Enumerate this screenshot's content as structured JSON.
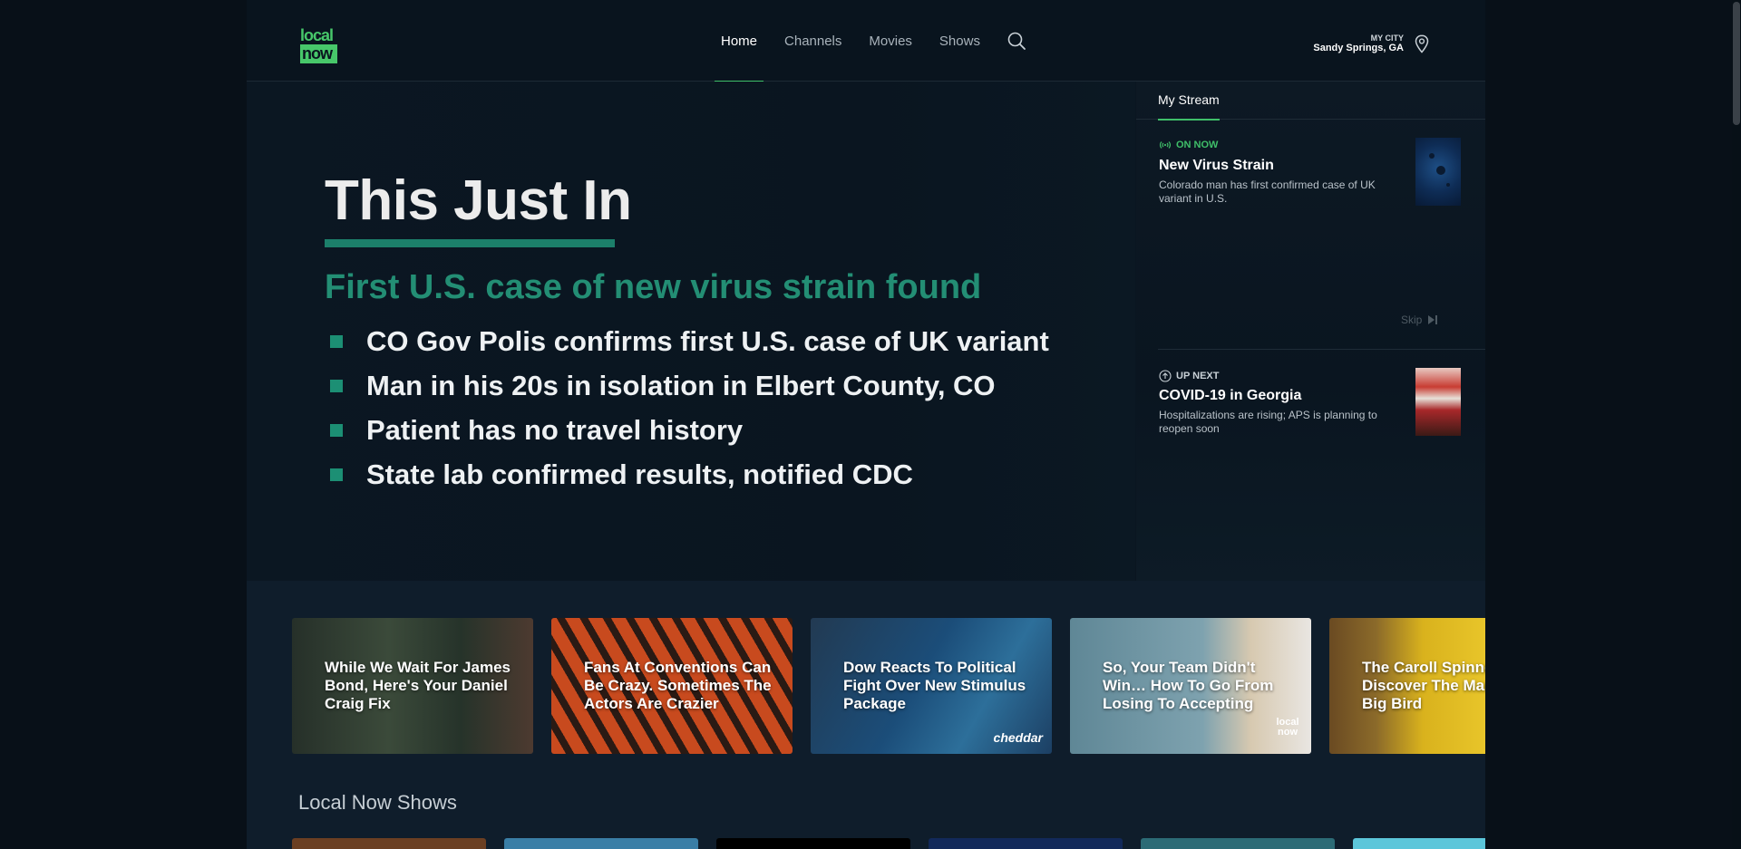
{
  "header": {
    "logo_top": "local",
    "logo_bottom": "now",
    "nav": [
      "Home",
      "Channels",
      "Movies",
      "Shows"
    ],
    "city_label": "MY CITY",
    "city_name": "Sandy Springs, GA"
  },
  "hero": {
    "title": "This Just In",
    "subtitle": "First U.S. case of new virus strain found",
    "bullets": [
      "CO Gov Polis confirms first U.S. case of UK variant",
      "Man in his 20s in isolation in Elbert County, CO",
      "Patient has no travel history",
      "State lab confirmed results, notified CDC"
    ]
  },
  "stream": {
    "tab": "My Stream",
    "now": {
      "status": "ON NOW",
      "title": "New Virus Strain",
      "desc": "Colorado man has first confirmed case of UK variant in U.S."
    },
    "skip": "Skip",
    "next": {
      "status": "UP NEXT",
      "title": "COVID-19 in Georgia",
      "desc": "Hospitalizations are rising; APS is planning to reopen soon"
    }
  },
  "promos": [
    {
      "title": "While We Wait For James Bond, Here's Your Daniel Craig Fix"
    },
    {
      "title": "Fans At Conventions Can Be Crazy. Sometimes The Actors Are Crazier"
    },
    {
      "title": "Dow Reacts To Political Fight Over New Stimulus Package",
      "badge": "cheddar"
    },
    {
      "title": "So, Your Team Didn't Win… How To Go From Losing To Accepting",
      "badge": "local now"
    },
    {
      "title": "The Caroll Spinney Story: Discover The Man Behind Big Bird"
    }
  ],
  "sections": {
    "shows_title": "Local Now Shows"
  },
  "colors": {
    "accent_green": "#3fbf69",
    "hero_teal": "#238e74",
    "background": "#0a1520"
  }
}
